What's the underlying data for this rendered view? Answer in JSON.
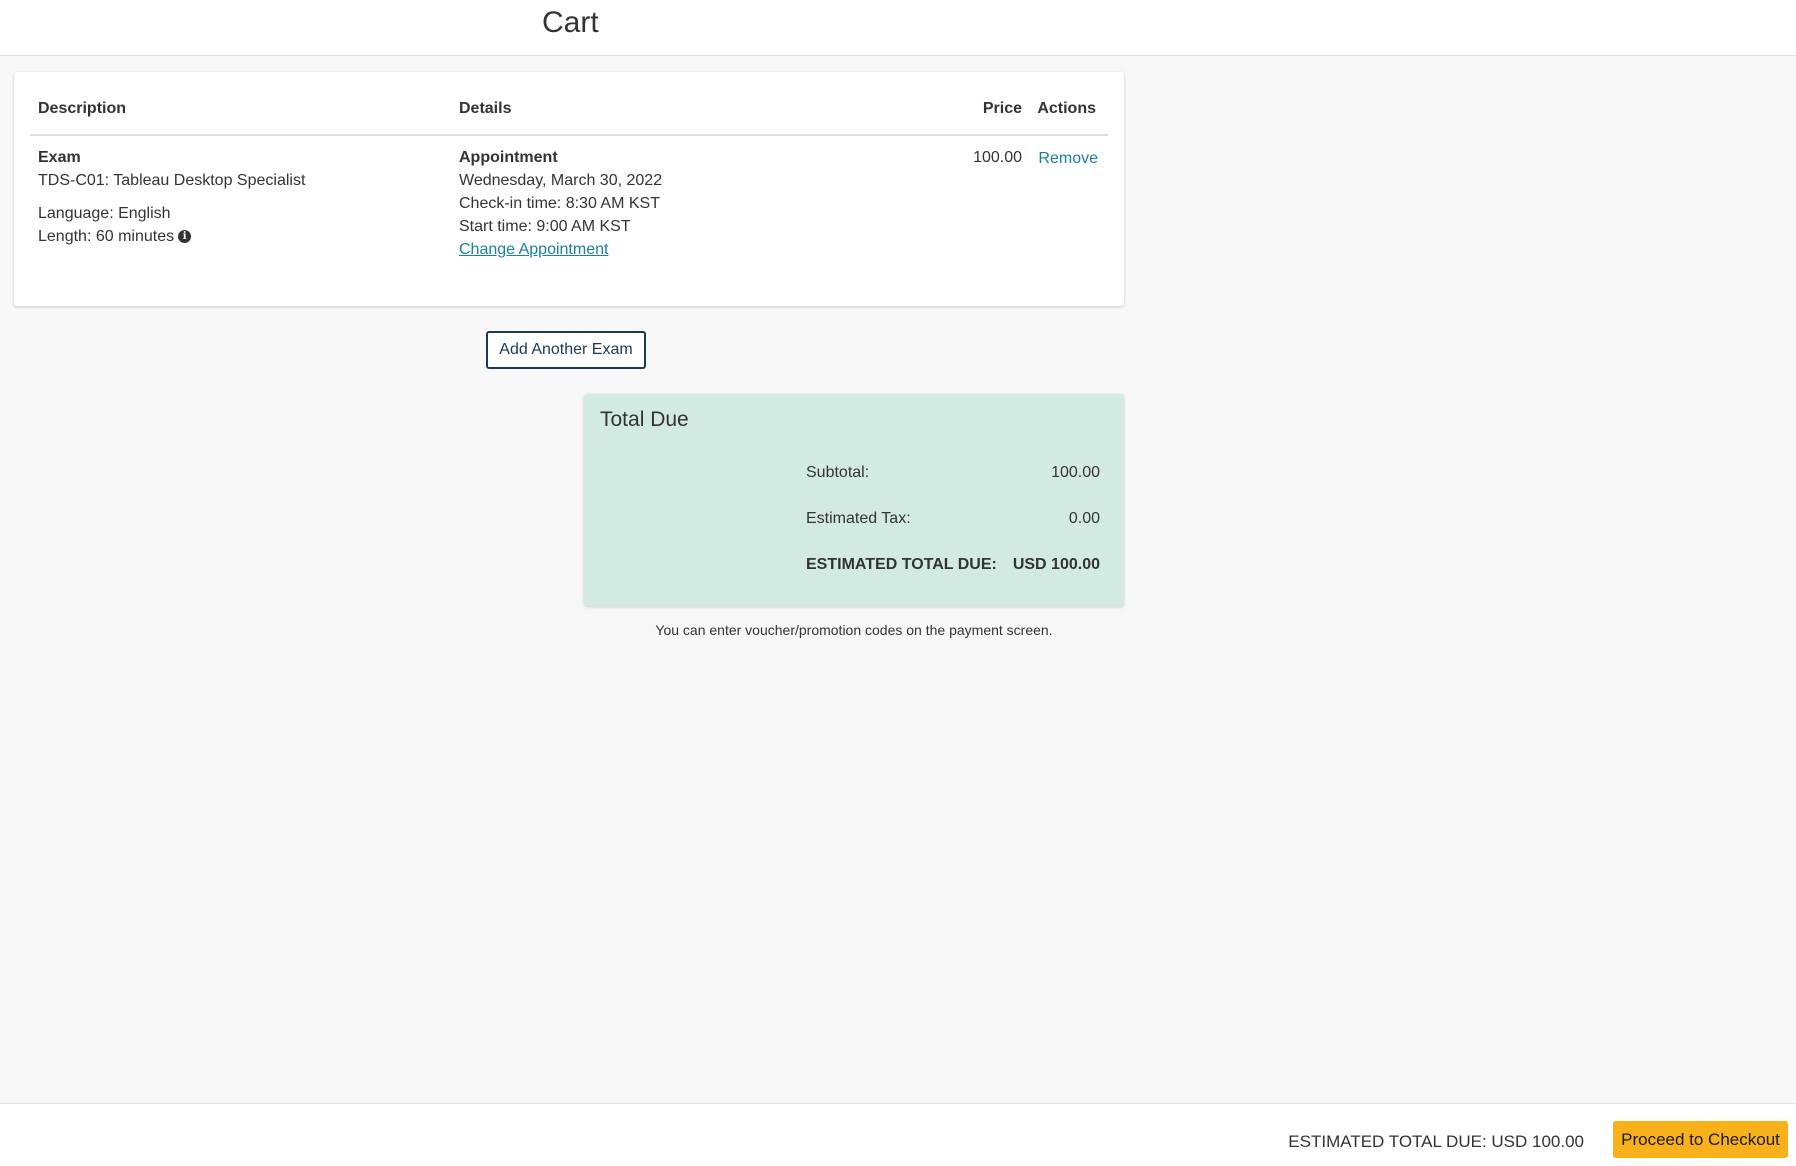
{
  "header": {
    "title": "Cart"
  },
  "table": {
    "columns": [
      "Description",
      "Details",
      "Price",
      "Actions"
    ],
    "row": {
      "description": {
        "type": "Exam",
        "name": "TDS-C01: Tableau Desktop Specialist",
        "language": "Language: English",
        "length": "Length: 60 minutes"
      },
      "details": {
        "heading": "Appointment",
        "date": "Wednesday, March 30, 2022",
        "checkin": "Check-in time: 8:30 AM KST",
        "start": "Start time: 9:00 AM KST",
        "change_link": "Change Appointment"
      },
      "price": "100.00",
      "action": "Remove"
    }
  },
  "add_exam_button": "Add Another Exam",
  "total_due": {
    "title": "Total Due",
    "subtotal_label": "Subtotal:",
    "subtotal_value": "100.00",
    "tax_label": "Estimated Tax:",
    "tax_value": "0.00",
    "total_label": "ESTIMATED TOTAL DUE:",
    "total_value": "USD 100.00"
  },
  "voucher_note": "You can enter voucher/promotion codes on the payment screen.",
  "footer": {
    "total_text": "ESTIMATED TOTAL DUE: USD 100.00",
    "checkout_button": "Proceed to Checkout"
  },
  "colors": {
    "link": "#1a7fa3",
    "total_card_bg": "#d3eae3",
    "checkout_button": "#f8b11b",
    "add_button_border": "#1b3a57"
  },
  "icons": {
    "length_info": "info-icon"
  }
}
